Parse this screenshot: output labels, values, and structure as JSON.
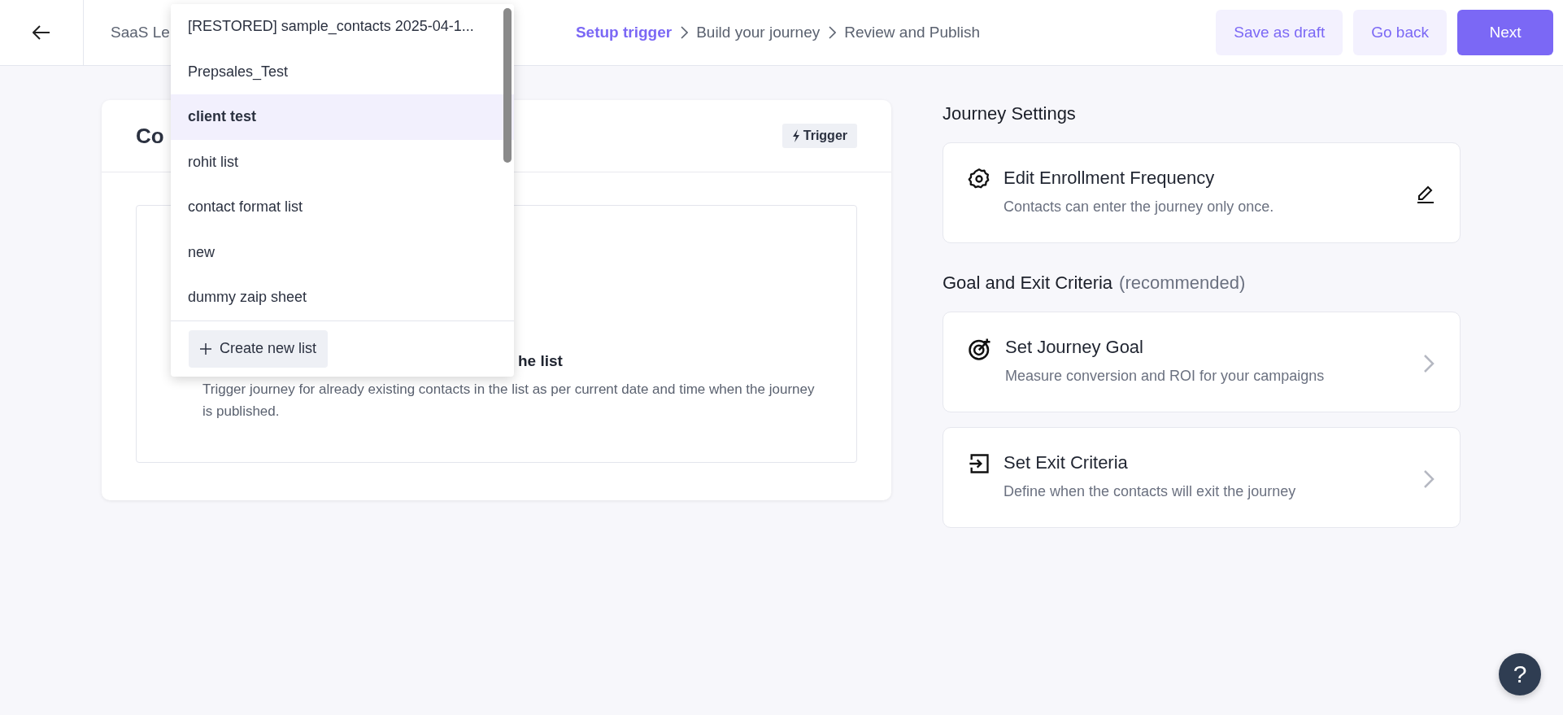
{
  "header": {
    "title": "SaaS Le",
    "steps": [
      {
        "label": "Setup trigger",
        "selected": true
      },
      {
        "label": "Build your journey",
        "selected": false
      },
      {
        "label": "Review and Publish",
        "selected": false
      }
    ],
    "buttons": [
      {
        "label": "Save as draft",
        "kind": "secondary"
      },
      {
        "label": "Go back",
        "kind": "secondary"
      },
      {
        "label": "Next",
        "kind": "primary"
      }
    ]
  },
  "trigger_card": {
    "title": "Co",
    "badge": "Trigger",
    "option": {
      "title": "he list",
      "description": "Trigger journey for already existing contacts in the list as per current date and time when the journey is published."
    }
  },
  "list_dropdown": {
    "items": [
      {
        "label": "[RESTORED] sample_contacts 2025-04-1...",
        "selected": false
      },
      {
        "label": "Prepsales_Test",
        "selected": false
      },
      {
        "label": "client test",
        "selected": true
      },
      {
        "label": "rohit list",
        "selected": false
      },
      {
        "label": "contact format list",
        "selected": false
      },
      {
        "label": "new",
        "selected": false
      },
      {
        "label": "dummy zaip sheet",
        "selected": false
      }
    ],
    "create_button": "Create new list"
  },
  "journey_settings": {
    "title": "Journey Settings",
    "cards": [
      {
        "title": "Edit Enrollment Frequency",
        "description": "Contacts can enter the journey only once.",
        "kind": "frequency"
      }
    ]
  },
  "goal_section": {
    "title": "Goal and Exit Criteria",
    "note": "(recommended)",
    "cards": [
      {
        "title": "Set Journey Goal",
        "description": "Measure conversion and ROI for your campaigns",
        "kind": "goal"
      },
      {
        "title": "Set Exit Criteria",
        "description": "Define when the contacts will exit the journey",
        "kind": "exit"
      }
    ]
  },
  "help_button": "?"
}
